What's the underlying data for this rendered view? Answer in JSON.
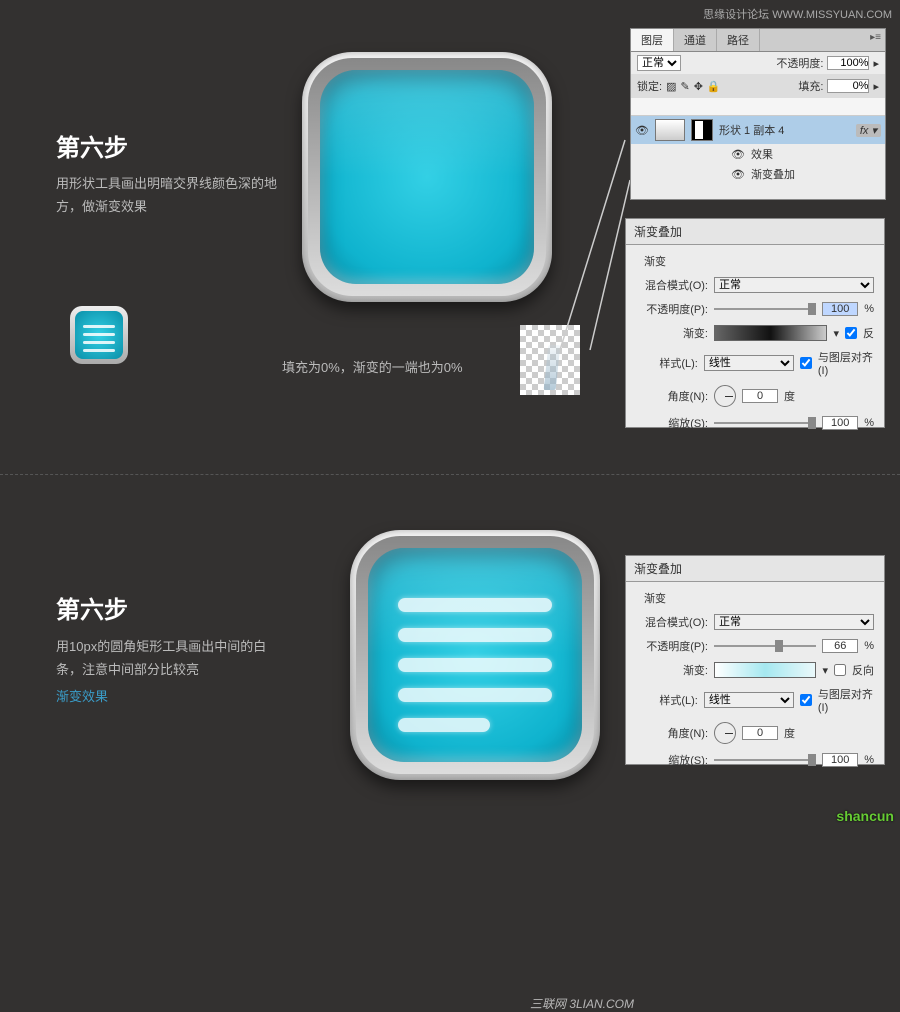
{
  "watermark": "思缘设计论坛  WWW.MISSYUAN.COM",
  "sanlian": "三联网 3LIAN.COM",
  "shancun": "shancun",
  "section1": {
    "title": "第六步",
    "desc": "用形状工具画出明暗交界线颜色深的地方，做渐变效果",
    "fill_note": "填充为0%，渐变的一端也为0%"
  },
  "section2": {
    "title": "第六步",
    "desc": "用10px的圆角矩形工具画出中间的白条，注意中间部分比较亮",
    "link": "渐变效果"
  },
  "layers_panel": {
    "tabs": [
      "图层",
      "通道",
      "路径"
    ],
    "menu_glyph": "▸≡",
    "blend_mode": "正常",
    "opacity_label": "不透明度:",
    "opacity_val": "100%",
    "opacity_arrow": "▸",
    "lock_label": "锁定:",
    "fill_label": "填充:",
    "fill_val": "0%",
    "fill_arrow": "▸",
    "eye": "👁",
    "layer_name": "形状 1 副本 4",
    "fx": "fx ▾",
    "effects_label": "效果",
    "grad_overlay_label": "渐变叠加"
  },
  "grad1": {
    "header": "渐变叠加",
    "sub": "渐变",
    "blend_label": "混合模式(O):",
    "blend_val": "正常",
    "opacity_label": "不透明度(P):",
    "opacity_val": "100",
    "pct": "%",
    "grad_label": "渐变:",
    "grad_arrow": "▾",
    "reverse_label": "反",
    "style_label": "样式(L):",
    "style_val": "线性",
    "style_arrow": "▾",
    "align_label": "与图层对齐(I)",
    "angle_label": "角度(N):",
    "angle_val": "0",
    "angle_unit": "度",
    "scale_label": "缩放(S):",
    "scale_val": "100",
    "scale_pct": "%"
  },
  "grad2": {
    "header": "渐变叠加",
    "sub": "渐变",
    "blend_label": "混合模式(O):",
    "blend_val": "正常",
    "opacity_label": "不透明度(P):",
    "opacity_val": "66",
    "pct": "%",
    "grad_label": "渐变:",
    "grad_arrow": "▾",
    "reverse_label": "反向",
    "style_label": "样式(L):",
    "style_val": "线性",
    "style_arrow": "▾",
    "align_label": "与图层对齐(I)",
    "angle_label": "角度(N):",
    "angle_val": "0",
    "angle_unit": "度",
    "scale_label": "缩放(S):",
    "scale_val": "100",
    "scale_pct": "%"
  }
}
